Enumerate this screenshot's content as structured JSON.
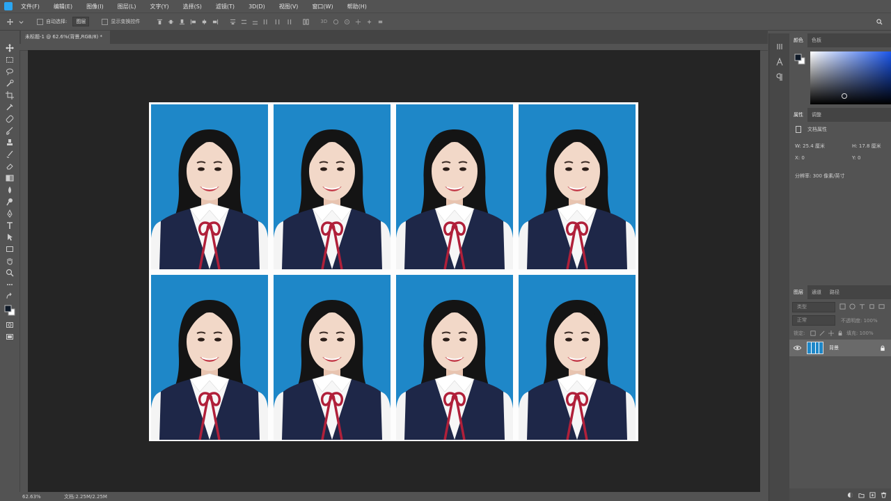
{
  "menu": [
    "文件(F)",
    "编辑(E)",
    "图像(I)",
    "图层(L)",
    "文字(Y)",
    "选择(S)",
    "滤镜(T)",
    "3D(D)",
    "视图(V)",
    "窗口(W)",
    "帮助(H)"
  ],
  "options_bar": {
    "auto_select_label": "自动选择:",
    "auto_select_value": "图层",
    "show_transform_label": "显示变换控件"
  },
  "document_tab": "未标题-1 @ 62.6%(背景,RGB/8) *",
  "status_bar": {
    "zoom": "62.63%",
    "doc_info": "文档:2.25M/2.25M"
  },
  "color_panel": {
    "tabs": [
      "颜色",
      "色板"
    ]
  },
  "properties_panel": {
    "tabs": [
      "属性",
      "调整"
    ],
    "section": "文档属性",
    "width_label": "W:",
    "width_value": "25.4 厘米",
    "height_label": "H:",
    "height_value": "17.8 厘米",
    "x_label": "X:",
    "x_value": "0",
    "y_label": "Y:",
    "y_value": "0",
    "resolution": "分辨率: 300 像素/英寸"
  },
  "layers_panel": {
    "tabs": [
      "图层",
      "通道",
      "路径"
    ],
    "filter_kind": "类型",
    "blend_mode": "正常",
    "opacity_label": "不透明度:",
    "opacity": "100%",
    "lock_label": "锁定:",
    "fill_label": "填充:",
    "fill": "100%",
    "layers": [
      {
        "name": "背景"
      }
    ]
  },
  "document": {
    "layout": "4 x 2",
    "photos": [
      {
        "id": "photo-1"
      },
      {
        "id": "photo-2"
      },
      {
        "id": "photo-3"
      },
      {
        "id": "photo-4"
      },
      {
        "id": "photo-5"
      },
      {
        "id": "photo-6"
      },
      {
        "id": "photo-7"
      },
      {
        "id": "photo-8"
      }
    ]
  },
  "colors": {
    "ui_bg": "#535353",
    "canvas_bg": "#252525",
    "photo_bg": "#1e87c8",
    "blazer": "#1e2748",
    "ribbon": "#b0203a",
    "accent_picker": "#1b56ea"
  }
}
